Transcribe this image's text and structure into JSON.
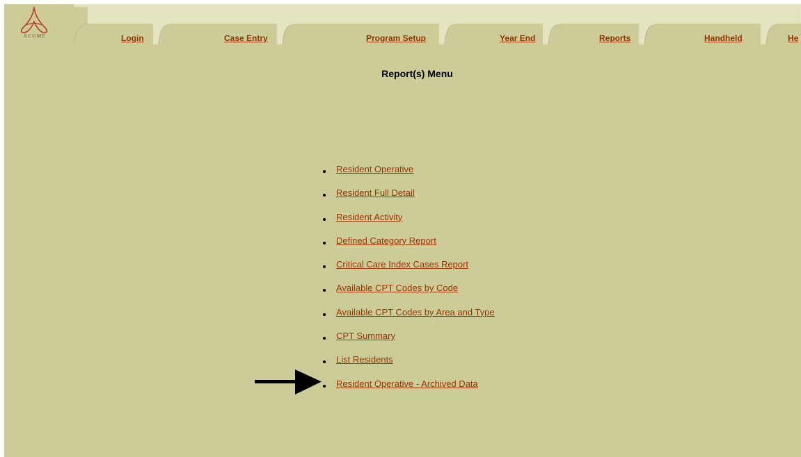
{
  "logo": {
    "text": "ACGME"
  },
  "nav": {
    "tabs": [
      {
        "label": "Login"
      },
      {
        "label": "Case Entry"
      },
      {
        "label": "Program Setup"
      },
      {
        "label": "Year End"
      },
      {
        "label": "Reports"
      },
      {
        "label": "Handheld"
      },
      {
        "label": "He"
      }
    ]
  },
  "page": {
    "title": "Report(s) Menu"
  },
  "menu": {
    "items": [
      {
        "label": "Resident Operative"
      },
      {
        "label": "Resident Full Detail"
      },
      {
        "label": "Resident Activity"
      },
      {
        "label": "Defined Category Report"
      },
      {
        "label": "Critical Care Index Cases Report"
      },
      {
        "label": "Available CPT Codes by Code"
      },
      {
        "label": "Available CPT Codes by Area and Type"
      },
      {
        "label": "CPT Summary"
      },
      {
        "label": "List Residents"
      },
      {
        "label": "Resident Operative - Archived Data"
      }
    ]
  },
  "colors": {
    "background": "#cccc99",
    "link": "#993300",
    "tab_band": "#e4e4c2",
    "logo": "#c0392b"
  }
}
